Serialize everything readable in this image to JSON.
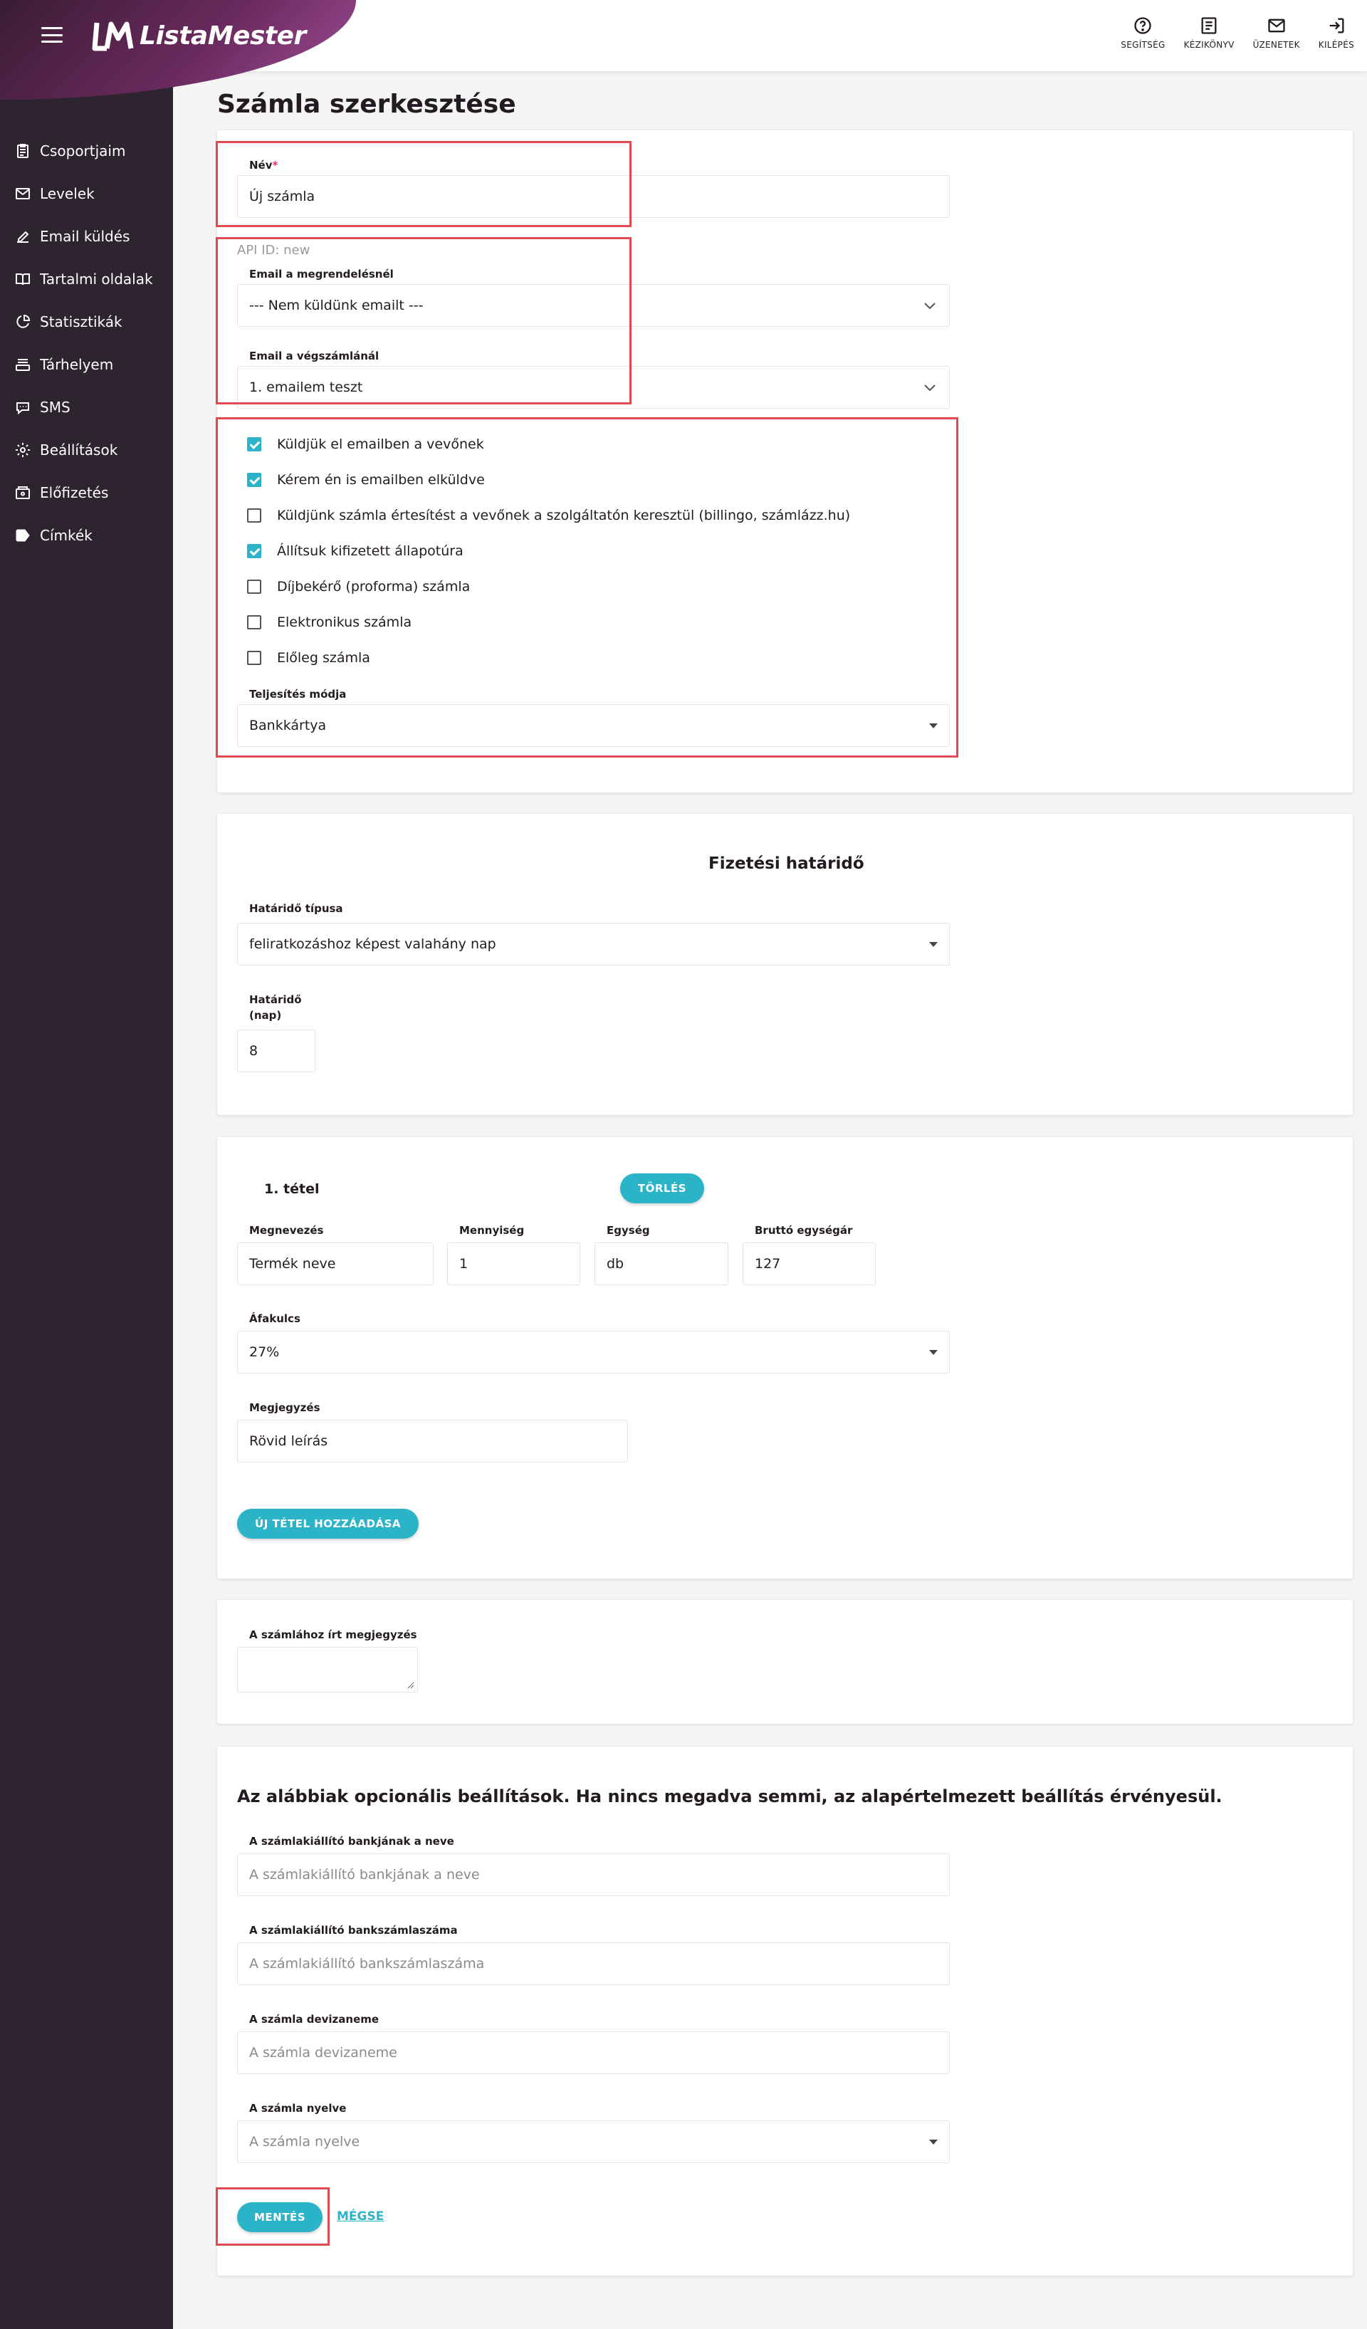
{
  "header": {
    "brand": "ListaMester",
    "actions": [
      {
        "label": "SEGÍTSÉG",
        "icon": "help-circle-icon"
      },
      {
        "label": "KÉZIKÖNYV",
        "icon": "book-icon"
      },
      {
        "label": "ÜZENETEK",
        "icon": "mail-icon"
      },
      {
        "label": "KILÉPÉS",
        "icon": "logout-icon"
      }
    ]
  },
  "sidebar": {
    "items": [
      {
        "label": "Csoportjaim",
        "icon": "clipboard-icon"
      },
      {
        "label": "Levelek",
        "icon": "envelope-icon"
      },
      {
        "label": "Email küldés",
        "icon": "pencil-icon"
      },
      {
        "label": "Tartalmi oldalak",
        "icon": "open-book-icon"
      },
      {
        "label": "Statisztikák",
        "icon": "pie-chart-icon"
      },
      {
        "label": "Tárhelyem",
        "icon": "storage-icon"
      },
      {
        "label": "SMS",
        "icon": "sms-icon"
      },
      {
        "label": "Beállítások",
        "icon": "gear-icon"
      },
      {
        "label": "Előfizetés",
        "icon": "wallet-icon"
      },
      {
        "label": "Címkék",
        "icon": "tag-icon"
      }
    ]
  },
  "page": {
    "title": "Számla szerkesztése"
  },
  "invoice": {
    "name_label": "Név",
    "name_required_mark": "*",
    "name_value": "Új számla",
    "api_id": "API ID: new",
    "email_order_label": "Email a megrendelésnél",
    "email_order_value": "--- Nem küldünk emailt ---",
    "email_final_label": "Email a végszámlánál",
    "email_final_value": "1. emailem teszt",
    "checkboxes": [
      {
        "label": "Küldjük el emailben a vevőnek",
        "checked": true
      },
      {
        "label": "Kérem én is emailben elküldve",
        "checked": true
      },
      {
        "label": "Küldjünk számla értesítést a vevőnek a szolgáltatón keresztül (billingo, számlázz.hu)",
        "checked": false
      },
      {
        "label": "Állítsuk kifizetett állapotúra",
        "checked": true
      },
      {
        "label": "Díjbekérő (proforma) számla",
        "checked": false
      },
      {
        "label": "Elektronikus számla",
        "checked": false
      },
      {
        "label": "Előleg számla",
        "checked": false
      }
    ],
    "payment_mode_label": "Teljesítés módja",
    "payment_mode_value": "Bankkártya"
  },
  "deadline": {
    "title": "Fizetési határidő",
    "type_label": "Határidő típusa",
    "type_value": "feliratkozáshoz képest valahány nap",
    "days_label_1": "Határidő",
    "days_label_2": "(nap)",
    "days_value": "8"
  },
  "items": {
    "item_title": "1. tétel",
    "delete_label": "TÖRLÉS",
    "name_label": "Megnevezés",
    "name_value": "Termék neve",
    "qty_label": "Mennyiség",
    "qty_value": "1",
    "unit_label": "Egység",
    "unit_value": "db",
    "price_label": "Bruttó egységár",
    "price_value": "127",
    "vat_label": "Áfakulcs",
    "vat_value": "27%",
    "note_label": "Megjegyzés",
    "note_value": "Rövid leírás",
    "add_label": "ÚJ TÉTEL HOZZÁADÁSA"
  },
  "invoice_note": {
    "label": "A számlához írt megjegyzés",
    "value": ""
  },
  "optional": {
    "title": "Az alábbiak opcionális beállítások. Ha nincs megadva semmi, az alapértelmezett beállítás érvényesül.",
    "bank_name_label": "A számlakiállító bankjának a neve",
    "bank_name_placeholder": "A számlakiállító bankjának a neve",
    "bank_account_label": "A számlakiállító bankszámlaszáma",
    "bank_account_placeholder": "A számlakiállító bankszámlaszáma",
    "currency_label": "A számla devizaneme",
    "currency_placeholder": "A számla devizaneme",
    "language_label": "A számla nyelve",
    "language_placeholder": "A számla nyelve",
    "save_label": "MENTÉS",
    "cancel_label": "MÉGSE"
  },
  "colors": {
    "accent": "#2bb3c8",
    "sidebar": "#2d2430",
    "highlight": "#e04a50",
    "brand_gradient_end": "#a04f9a"
  }
}
